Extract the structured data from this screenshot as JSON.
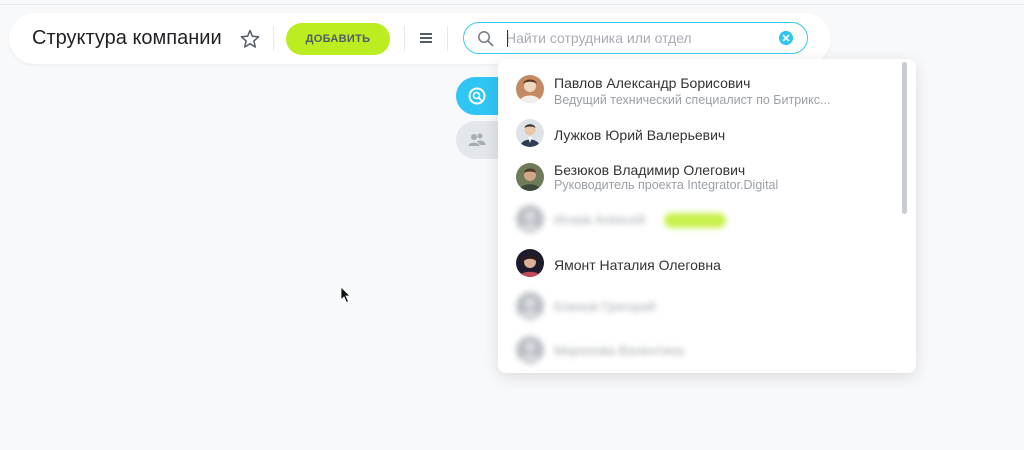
{
  "header": {
    "title": "Структура компании",
    "add_label": "ДОБАВИТЬ"
  },
  "search": {
    "placeholder": "Найти сотрудника или отдел",
    "value": ""
  },
  "colors": {
    "accent": "#2fc6f6",
    "add_button": "#bbed21",
    "background": "#f8f9fb"
  },
  "icons": [
    "star-icon",
    "menu-icon",
    "search-icon",
    "clear-icon",
    "search-tab-icon",
    "users-icon"
  ],
  "results": [
    {
      "name": "Павлов Александр Борисович",
      "position": "Ведущий технический специалист по Битрикс..."
    },
    {
      "name": "Лужков Юрий Валерьевич",
      "position": ""
    },
    {
      "name": "Безюков Владимир Олегович",
      "position": "Руководитель проекта Integrator.Digital"
    },
    {
      "name": "Исаев Алексей",
      "position": ""
    },
    {
      "name": "Ямонт Наталия Олеговна",
      "position": ""
    },
    {
      "name": "Клинов Григорий",
      "position": ""
    },
    {
      "name": "Миронова Валентина",
      "position": ""
    }
  ]
}
